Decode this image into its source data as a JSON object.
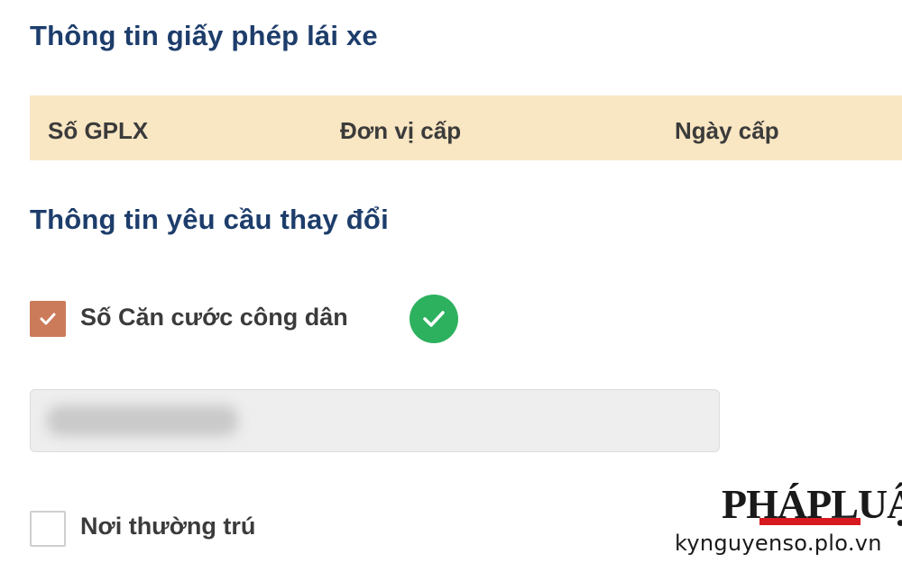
{
  "license_section": {
    "title": "Thông tin giấy phép lái xe",
    "table_headers": [
      "Số GPLX",
      "Đơn vị cấp",
      "Ngày cấp"
    ]
  },
  "request_section": {
    "title": "Thông tin yêu cầu thay đổi",
    "options": [
      {
        "label": "Số Căn cước công dân",
        "checked": true,
        "verified": true,
        "verified_icon": "check-circle-icon",
        "input_value_blurred": true
      },
      {
        "label": "Nơi thường trú",
        "checked": false
      }
    ]
  },
  "watermark": {
    "logo_text": "PHÁPLUẬT",
    "url": "kynguyenso.plo.vn"
  },
  "colors": {
    "title": "#1d3d6b",
    "table_header_bg": "#f9e6c2",
    "checkbox_checked": "#cc7b5a",
    "verified_green": "#2db15f",
    "logo_red": "#d71920"
  }
}
